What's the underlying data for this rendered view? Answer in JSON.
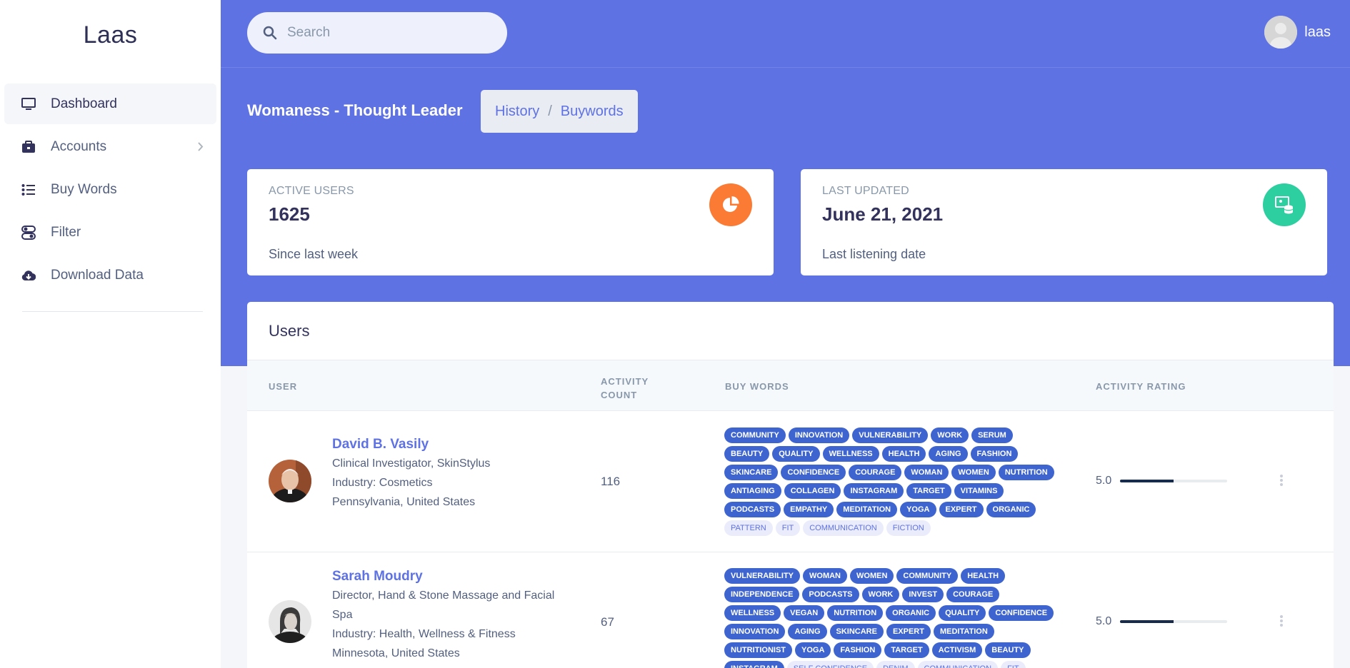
{
  "app": {
    "brand": "Laas"
  },
  "sidebar": {
    "items": [
      {
        "label": "Dashboard",
        "icon": "monitor-icon",
        "active": true
      },
      {
        "label": "Accounts",
        "icon": "briefcase-icon"
      },
      {
        "label": "Buy Words",
        "icon": "list-icon"
      },
      {
        "label": "Filter",
        "icon": "filter-icon"
      },
      {
        "label": "Download Data",
        "icon": "cloud-download-icon"
      }
    ]
  },
  "header": {
    "search_placeholder": "Search",
    "user_name": "laas"
  },
  "page": {
    "title": "Womaness - Thought Leader",
    "breadcrumb": [
      "History",
      "Buywords"
    ],
    "breadcrumb_sep": "/"
  },
  "stats": [
    {
      "label": "ACTIVE USERS",
      "value": "1625",
      "sub": "Since last week",
      "icon": "pie-chart-icon",
      "color": "#fb7a34"
    },
    {
      "label": "LAST UPDATED",
      "value": "June 21, 2021",
      "sub": "Last listening date",
      "icon": "database-icon",
      "color": "#2dce9f"
    }
  ],
  "users": {
    "title": "Users",
    "columns": {
      "user": "USER",
      "count_1": "ACTIVITY",
      "count_2": "COUNT",
      "buy_words": "BUY WORDS",
      "rating": "ACTIVITY RATING"
    },
    "rows": [
      {
        "name": "David B. Vasily",
        "lines": [
          "Clinical Investigator, SkinStylus",
          "Industry: Cosmetics",
          "Pennsylvania, United States"
        ],
        "count": "116",
        "tags": [
          "COMMUNITY",
          "INNOVATION",
          "VULNERABILITY",
          "WORK",
          "SERUM",
          "BEAUTY",
          "QUALITY",
          "WELLNESS",
          "HEALTH",
          "AGING",
          "FASHION",
          "SKINCARE",
          "CONFIDENCE",
          "COURAGE",
          "WOMAN",
          "WOMEN",
          "NUTRITION",
          "ANTIAGING",
          "COLLAGEN",
          "INSTAGRAM",
          "TARGET",
          "VITAMINS",
          "PODCASTS",
          "EMPATHY",
          "MEDITATION",
          "YOGA",
          "EXPERT",
          "ORGANIC"
        ],
        "light_tags": [
          "PATTERN",
          "FIT",
          "COMMUNICATION",
          "FICTION"
        ],
        "rating": "5.0",
        "rating_fraction": 0.5
      },
      {
        "name": "Sarah Moudry",
        "lines": [
          "Director, Hand & Stone Massage and Facial Spa",
          "Industry: Health, Wellness & Fitness",
          "Minnesota, United States"
        ],
        "count": "67",
        "tags": [
          "VULNERABILITY",
          "WOMAN",
          "WOMEN",
          "COMMUNITY",
          "HEALTH",
          "INDEPENDENCE",
          "PODCASTS",
          "WORK",
          "INVEST",
          "COURAGE",
          "WELLNESS",
          "VEGAN",
          "NUTRITION",
          "ORGANIC",
          "QUALITY",
          "CONFIDENCE",
          "INNOVATION",
          "AGING",
          "SKINCARE",
          "EXPERT",
          "MEDITATION",
          "NUTRITIONIST",
          "YOGA",
          "FASHION",
          "TARGET",
          "ACTIVISM",
          "BEAUTY",
          "INSTAGRAM"
        ],
        "light_tags": [
          "SELF CONFIDENCE",
          "DENIM",
          "COMMUNICATION",
          "FIT"
        ],
        "rating": "5.0",
        "rating_fraction": 0.5
      }
    ]
  }
}
